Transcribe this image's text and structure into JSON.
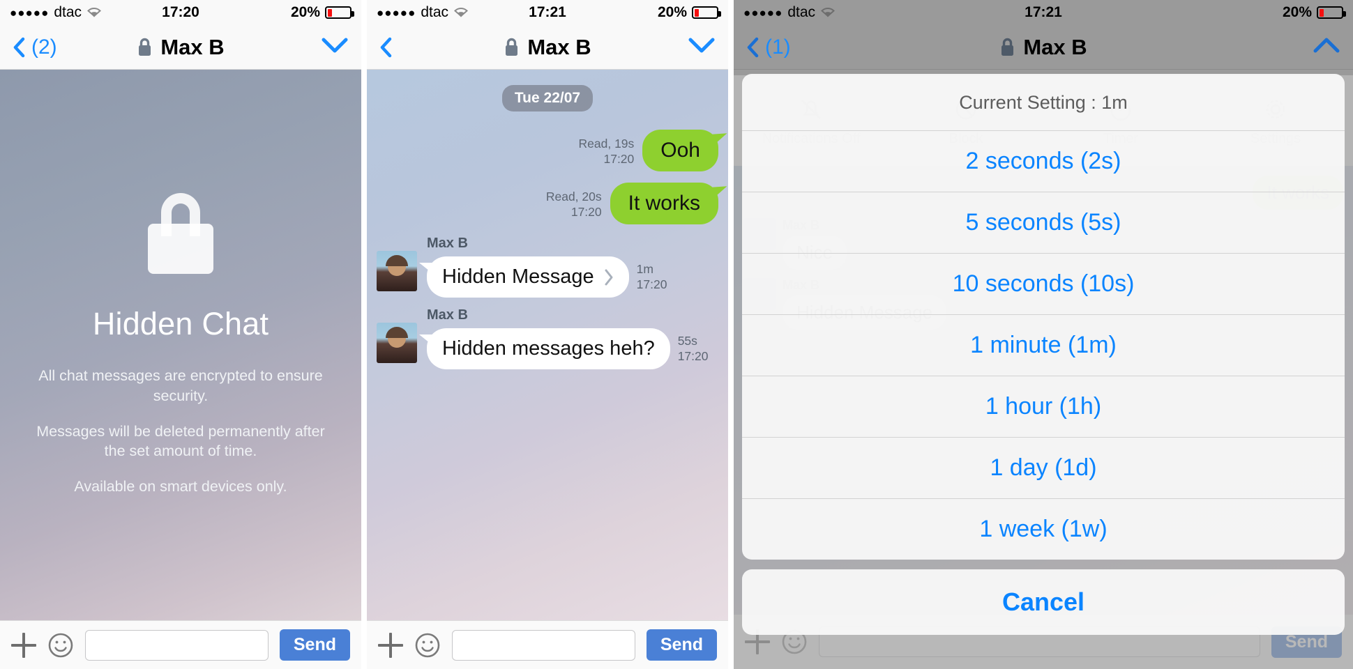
{
  "colors": {
    "accent_blue": "#0a84ff",
    "nav_blue": "#1a8cff",
    "send_blue": "#4a80d6",
    "bubble_green": "#8ed02f",
    "battery_red": "#f50f0f",
    "dim_gray": "#9a9a9a"
  },
  "panel1": {
    "status": {
      "signal_dots": "●●●●●",
      "carrier": "dtac",
      "wifi_icon": "wifi-icon",
      "time": "17:20",
      "battery_percent": "20%",
      "battery_icon": "battery-icon"
    },
    "nav": {
      "back_icon": "chevron-left-icon",
      "back_label": "(2)",
      "lock_icon": "lock-icon",
      "title": "Max B",
      "menu_icon": "chevron-down-icon"
    },
    "hidden": {
      "lock_icon": "lock-icon",
      "title": "Hidden Chat",
      "line1": "All chat messages are encrypted to ensure security.",
      "line2": "Messages will be deleted permanently after the set amount of time.",
      "line3": "Available on smart devices only."
    },
    "input": {
      "plus_icon": "plus-icon",
      "emoji_icon": "smiley-icon",
      "field_value": "",
      "field_placeholder": "",
      "send_label": "Send"
    }
  },
  "panel2": {
    "status": {
      "signal_dots": "●●●●●",
      "carrier": "dtac",
      "wifi_icon": "wifi-icon",
      "time": "17:21",
      "battery_percent": "20%",
      "battery_icon": "battery-icon"
    },
    "nav": {
      "back_icon": "chevron-left-icon",
      "back_label": "",
      "lock_icon": "lock-icon",
      "title": "Max B",
      "menu_icon": "chevron-down-icon"
    },
    "chat": {
      "date_divider": "Tue 22/07",
      "messages": [
        {
          "direction": "out",
          "text": "Ooh",
          "status": "Read,",
          "elapsed": "19s",
          "time": "17:20"
        },
        {
          "direction": "out",
          "text": "It works",
          "status": "Read,",
          "elapsed": "20s",
          "time": "17:20"
        },
        {
          "direction": "in",
          "sender": "Max B",
          "text": "Hidden Message",
          "has_chevron": true,
          "elapsed": "1m",
          "time": "17:20"
        },
        {
          "direction": "in",
          "sender": "Max B",
          "text": "Hidden messages heh?",
          "has_chevron": false,
          "elapsed": "55s",
          "time": "17:20"
        }
      ]
    },
    "input": {
      "plus_icon": "plus-icon",
      "emoji_icon": "smiley-icon",
      "field_value": "",
      "send_label": "Send"
    }
  },
  "panel3": {
    "status": {
      "signal_dots": "●●●●●",
      "carrier": "dtac",
      "wifi_icon": "wifi-icon",
      "time": "17:21",
      "battery_percent": "20%",
      "battery_icon": "battery-icon"
    },
    "nav": {
      "back_icon": "chevron-left-icon",
      "back_label": "(1)",
      "lock_icon": "lock-icon",
      "title": "Max B",
      "menu_icon": "chevron-up-icon"
    },
    "toolbar": [
      {
        "icon": "bell-off-icon",
        "label": "Notifications Off"
      },
      {
        "icon": "block-icon",
        "label": "Block"
      },
      {
        "icon": "timer-icon",
        "label": "Timer"
      },
      {
        "icon": "gear-icon",
        "label": "Settings"
      }
    ],
    "background_chat": {
      "messages": [
        {
          "direction": "out",
          "text": "It works"
        },
        {
          "direction": "in",
          "sender": "Max B",
          "text": "Nice"
        },
        {
          "direction": "in",
          "sender": "Max B",
          "text": "Hidden Message"
        }
      ]
    },
    "sheet": {
      "header": "Current Setting : 1m",
      "options": [
        "2 seconds (2s)",
        "5 seconds (5s)",
        "10 seconds (10s)",
        "1 minute (1m)",
        "1 hour (1h)",
        "1 day (1d)",
        "1 week (1w)"
      ],
      "cancel_label": "Cancel"
    },
    "input": {
      "plus_icon": "plus-icon",
      "emoji_icon": "smiley-icon",
      "send_label": "Send"
    }
  }
}
